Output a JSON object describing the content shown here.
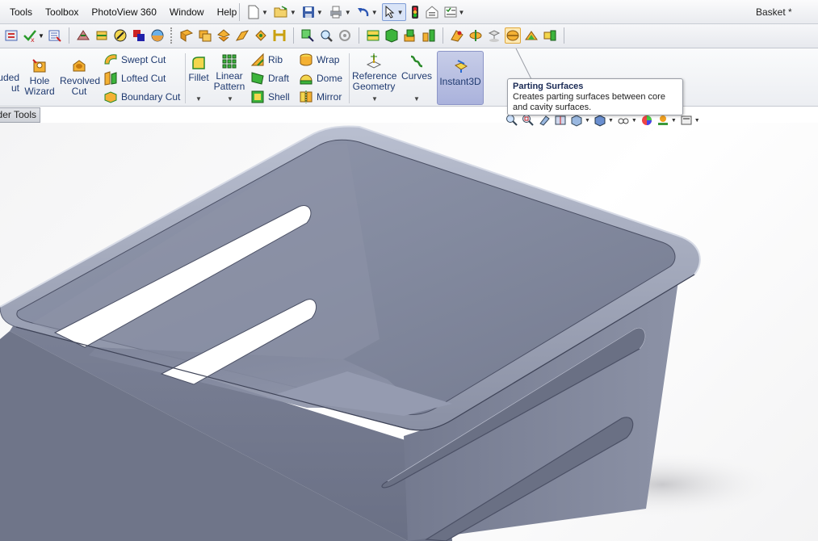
{
  "menubar": {
    "items": [
      "Tools",
      "Toolbox",
      "PhotoView 360",
      "Window",
      "Help"
    ],
    "document_title": "Basket *"
  },
  "quick_toolbar": {
    "buttons": [
      "new-icon",
      "open-icon",
      "save-icon",
      "print-icon",
      "undo-icon",
      "select-icon",
      "rebuild-icon",
      "file-properties-icon",
      "options-icon"
    ]
  },
  "command_toolbar": {
    "selected": "parting-surfaces-icon"
  },
  "ribbon": {
    "extruded_cut": "uded\nut",
    "hole_wizard": [
      "Hole",
      "Wizard"
    ],
    "revolved_cut": [
      "Revolved",
      "Cut"
    ],
    "swept_cut": "Swept Cut",
    "lofted_cut": "Lofted Cut",
    "boundary_cut": "Boundary Cut",
    "fillet": "Fillet",
    "linear_pattern": [
      "Linear",
      "Pattern"
    ],
    "rib": "Rib",
    "draft": "Draft",
    "shell": "Shell",
    "wrap": "Wrap",
    "dome": "Dome",
    "mirror": "Mirror",
    "reference_geometry": [
      "Reference",
      "Geometry"
    ],
    "curves": "Curves",
    "instant3d": "Instant3D"
  },
  "tab": {
    "label": "der Tools"
  },
  "tooltip": {
    "title": "Parting Surfaces",
    "description": "Creates parting surfaces between core and cavity surfaces."
  },
  "colors": {
    "model_body": "#7d8396",
    "model_inner": "#9aa0b3",
    "ribbon_text": "#1f3a70",
    "instant3d_bg": "#b8bfe2"
  }
}
